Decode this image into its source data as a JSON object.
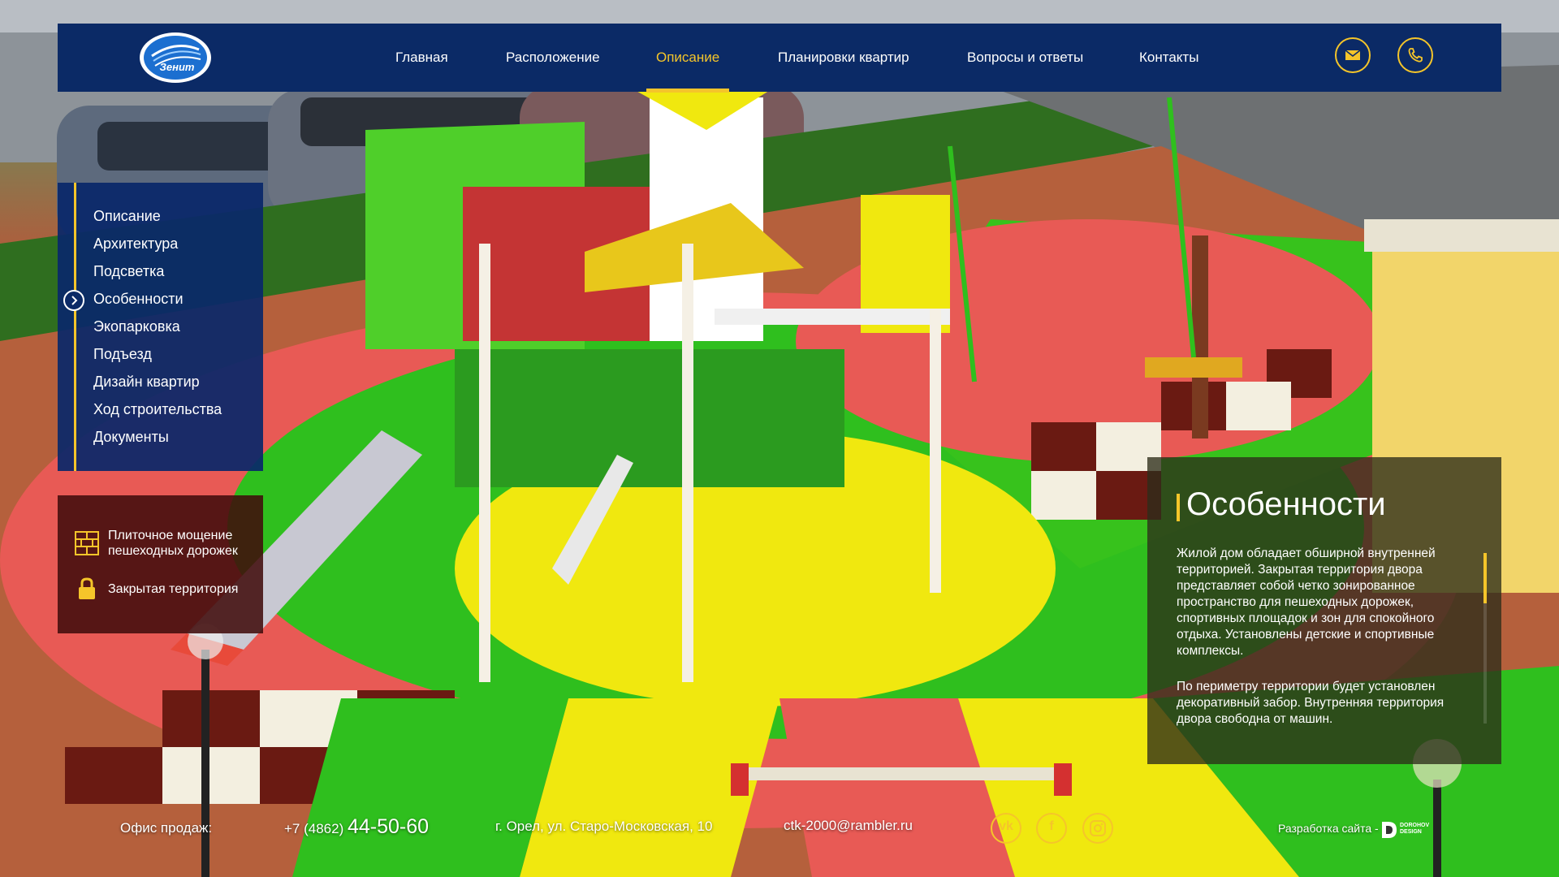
{
  "brand": {
    "logo_text": "Зенит"
  },
  "nav": {
    "items": [
      {
        "label": "Главная"
      },
      {
        "label": "Расположение"
      },
      {
        "label": "Описание",
        "active": true
      },
      {
        "label": "Планировки квартир"
      },
      {
        "label": "Вопросы и ответы"
      },
      {
        "label": "Контакты"
      }
    ],
    "icons": [
      "mail-icon",
      "phone-icon"
    ]
  },
  "submenu": {
    "items": [
      {
        "label": "Описание"
      },
      {
        "label": "Архитектура"
      },
      {
        "label": "Подсветка"
      },
      {
        "label": "Особенности",
        "active": true
      },
      {
        "label": "Экопарковка"
      },
      {
        "label": "Подъезд"
      },
      {
        "label": "Дизайн квартир"
      },
      {
        "label": "Ход строительства"
      },
      {
        "label": "Документы"
      }
    ]
  },
  "features": {
    "items": [
      {
        "icon": "tiles-icon",
        "label": "Плиточное мощение пешеходных дорожек"
      },
      {
        "icon": "lock-icon",
        "label": "Закрытая территория"
      }
    ]
  },
  "info": {
    "title": "Особенности",
    "paragraphs": [
      "Жилой дом обладает обширной внутренней территорией. Закрытая территория двора представляет собой четко зонированное пространство для пешеходных дорожек, спортивных площадок и зон для спокойного отдыха. Установлены детские и спортивные комплексы.",
      "По периметру территории будет установлен декоративный забор. Внутренняя территория двора свободна от машин."
    ]
  },
  "footer": {
    "office_label": "Офис продаж:",
    "phone_prefix": "+7 (4862)",
    "phone_number": "44-50-60",
    "address": "г. Орел, ул. Старо-Московская, 10",
    "email": "ctk-2000@rambler.ru",
    "socials": [
      "vk-icon",
      "facebook-icon",
      "instagram-icon"
    ],
    "developer_label": "Разработка сайта -",
    "developer_logo_text": "DOROHOV DESIGN"
  },
  "colors": {
    "header_bg": "#0b2a66",
    "accent": "#f5c52a",
    "submenu_bg": "#0a2869",
    "features_bg": "#410c0c",
    "info_bg": "#2d2d19"
  }
}
